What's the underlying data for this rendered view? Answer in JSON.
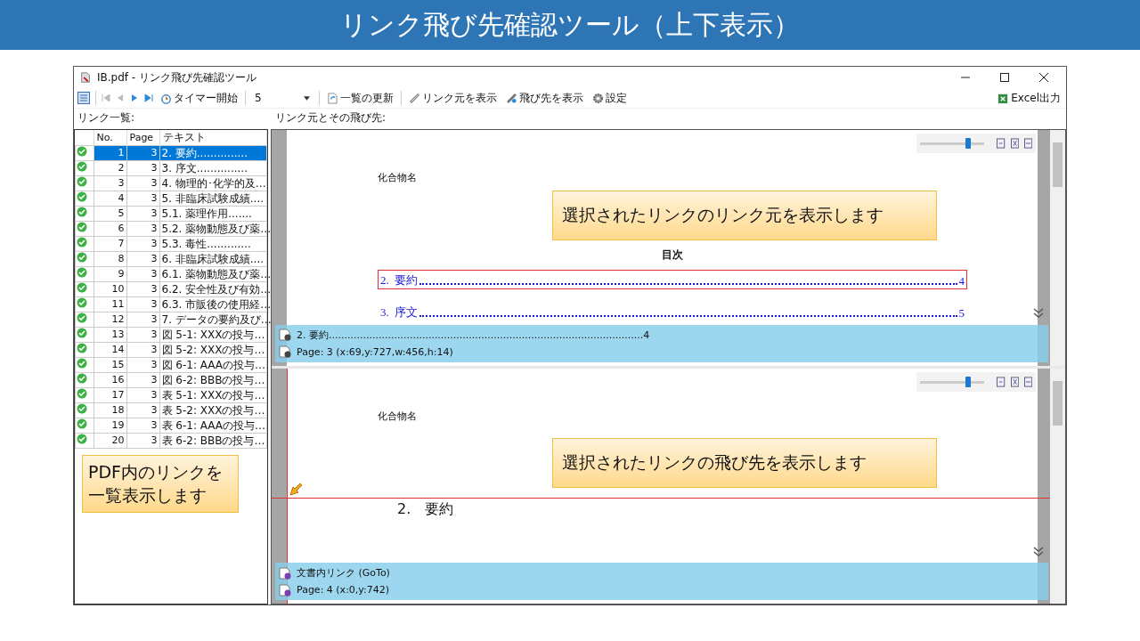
{
  "slide_title": "リンク飛び先確認ツール（上下表示）",
  "window": {
    "title": "IB.pdf - リンク飛び先確認ツール"
  },
  "toolbar": {
    "timer": "タイマー開始",
    "interval": "5",
    "refresh": "一覧の更新",
    "show_source": "リンク元を表示",
    "show_target": "飛び先を表示",
    "settings": "設定",
    "excel": "Excel出力"
  },
  "list_label": "リンク一覧:",
  "viewer_label": "リンク元とその飛び先:",
  "table": {
    "columns": [
      "No.",
      "Page",
      "テキスト"
    ],
    "rows": [
      {
        "no": "1",
        "page": "3",
        "text": "2. 要約...............",
        "ok": true,
        "selected": true
      },
      {
        "no": "2",
        "page": "3",
        "text": "3. 序文...............",
        "ok": true,
        "selected": false
      },
      {
        "no": "3",
        "page": "3",
        "text": "4. 物理的･化学的及…",
        "ok": true,
        "selected": false
      },
      {
        "no": "4",
        "page": "3",
        "text": "5. 非臨床試験成績....",
        "ok": true,
        "selected": false
      },
      {
        "no": "5",
        "page": "3",
        "text": "5.1. 薬理作用.......",
        "ok": true,
        "selected": false
      },
      {
        "no": "6",
        "page": "3",
        "text": "5.2. 薬物動態及び薬…",
        "ok": true,
        "selected": false
      },
      {
        "no": "7",
        "page": "3",
        "text": "5.3. 毒性.............",
        "ok": true,
        "selected": false
      },
      {
        "no": "8",
        "page": "3",
        "text": "6. 非臨床試験成績....",
        "ok": true,
        "selected": false
      },
      {
        "no": "9",
        "page": "3",
        "text": "6.1. 薬物動態及び薬…",
        "ok": true,
        "selected": false
      },
      {
        "no": "10",
        "page": "3",
        "text": "6.2. 安全性及び有効…",
        "ok": true,
        "selected": false
      },
      {
        "no": "11",
        "page": "3",
        "text": "6.3. 市販後の使用経…",
        "ok": true,
        "selected": false
      },
      {
        "no": "12",
        "page": "3",
        "text": "7. データの要約及び…",
        "ok": true,
        "selected": false
      },
      {
        "no": "13",
        "page": "3",
        "text": "図 5-1: XXXの投与…",
        "ok": true,
        "selected": false
      },
      {
        "no": "14",
        "page": "3",
        "text": "図 5-2: XXXの投与…",
        "ok": true,
        "selected": false
      },
      {
        "no": "15",
        "page": "3",
        "text": "図 6-1: AAAの投与…",
        "ok": true,
        "selected": false
      },
      {
        "no": "16",
        "page": "3",
        "text": "図 6-2: BBBの投与…",
        "ok": true,
        "selected": false
      },
      {
        "no": "17",
        "page": "3",
        "text": "表 5-1: XXXの投与…",
        "ok": true,
        "selected": false
      },
      {
        "no": "18",
        "page": "3",
        "text": "表 5-2: XXXの投与…",
        "ok": true,
        "selected": false
      },
      {
        "no": "19",
        "page": "3",
        "text": "表 6-1: AAAの投与…",
        "ok": true,
        "selected": false
      },
      {
        "no": "20",
        "page": "3",
        "text": "表 6-2: BBBの投与…",
        "ok": true,
        "selected": false
      }
    ]
  },
  "list_callout": "PDF内のリンクを一覧表示します",
  "source_pane": {
    "zoom": {
      "level": 0.75
    },
    "header": "化合物名",
    "toc_title": "目次",
    "toc": [
      {
        "label": "2.  要約",
        "page": "4",
        "highlighted": true
      },
      {
        "label": "3.  序文",
        "page": "5",
        "highlighted": false
      }
    ],
    "callout": "選択されたリンクのリンク元を表示します",
    "info": [
      "2. 要約.....................................................................................................4",
      "Page: 3 (x:69,y:727,w:456,h:14)"
    ]
  },
  "target_pane": {
    "zoom": {
      "level": 0.75
    },
    "header": "化合物名",
    "heading": "2.　要約",
    "callout": "選択されたリンクの飛び先を表示します",
    "info": [
      "文書内リンク (GoTo)",
      "Page: 4 (x:0,y:742)"
    ]
  }
}
